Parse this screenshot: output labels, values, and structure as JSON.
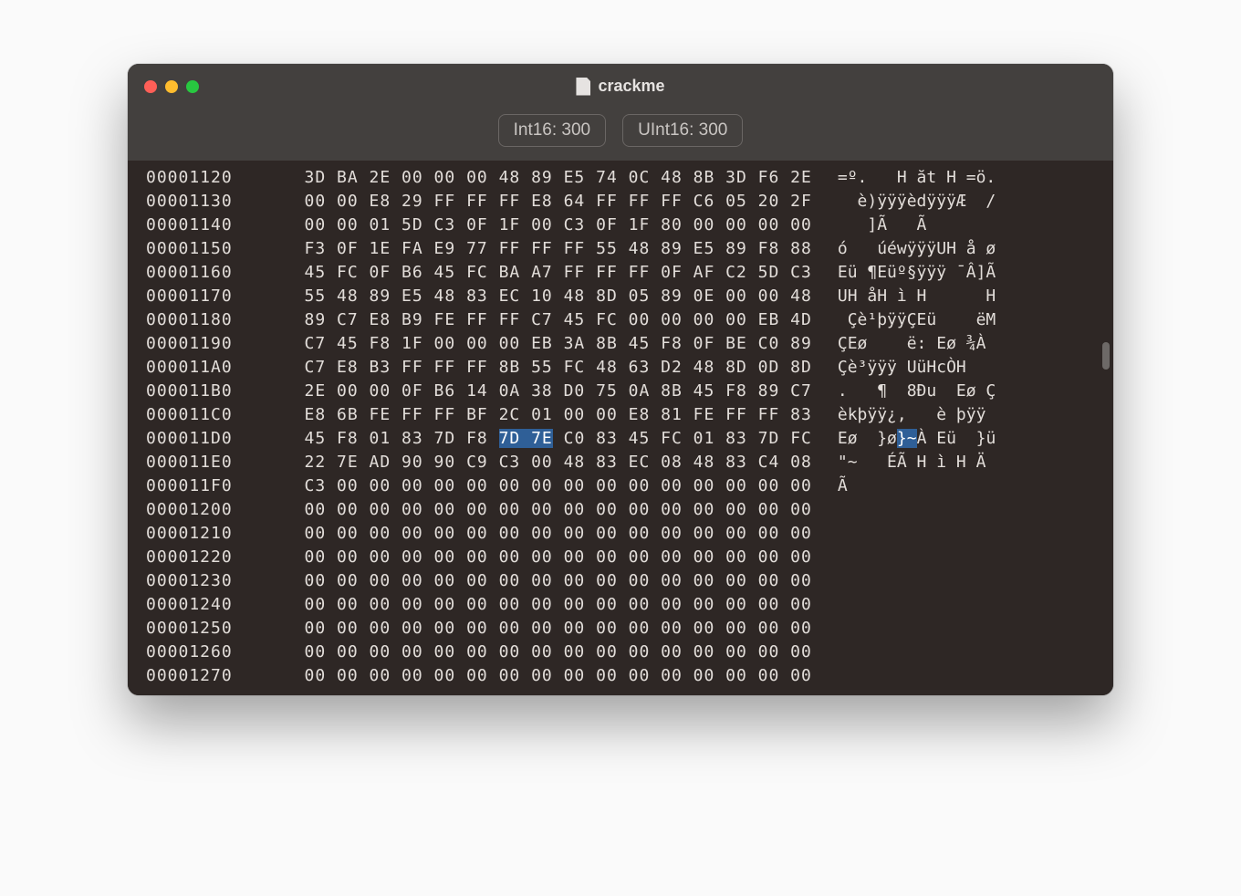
{
  "window": {
    "title": "crackme"
  },
  "info": {
    "int16": "Int16: 300",
    "uint16": "UInt16: 300"
  },
  "selection": {
    "row": 11,
    "hex_start": 6,
    "hex_end": 7,
    "ascii_col": 6
  },
  "rows": [
    {
      "addr": "00001120",
      "hex": [
        "3D",
        "BA",
        "2E",
        "00",
        "00",
        "00",
        "48",
        "89",
        "E5",
        "74",
        "0C",
        "48",
        "8B",
        "3D",
        "F6",
        "2E"
      ],
      "ascii": "=º.   H ăt H =ö."
    },
    {
      "addr": "00001130",
      "hex": [
        "00",
        "00",
        "E8",
        "29",
        "FF",
        "FF",
        "FF",
        "E8",
        "64",
        "FF",
        "FF",
        "FF",
        "C6",
        "05",
        "20",
        "2F"
      ],
      "ascii": "  è)ÿÿÿèdÿÿÿÆ  /"
    },
    {
      "addr": "00001140",
      "hex": [
        "00",
        "00",
        "01",
        "5D",
        "C3",
        "0F",
        "1F",
        "00",
        "C3",
        "0F",
        "1F",
        "80",
        "00",
        "00",
        "00",
        "00"
      ],
      "ascii": "   ]Ã   Ã       "
    },
    {
      "addr": "00001150",
      "hex": [
        "F3",
        "0F",
        "1E",
        "FA",
        "E9",
        "77",
        "FF",
        "FF",
        "FF",
        "55",
        "48",
        "89",
        "E5",
        "89",
        "F8",
        "88"
      ],
      "ascii": "ó   úéwÿÿÿUH å ø"
    },
    {
      "addr": "00001160",
      "hex": [
        "45",
        "FC",
        "0F",
        "B6",
        "45",
        "FC",
        "BA",
        "A7",
        "FF",
        "FF",
        "FF",
        "0F",
        "AF",
        "C2",
        "5D",
        "C3"
      ],
      "ascii": "Eü ¶Eüº§ÿÿÿ ¯Â]Ã"
    },
    {
      "addr": "00001170",
      "hex": [
        "55",
        "48",
        "89",
        "E5",
        "48",
        "83",
        "EC",
        "10",
        "48",
        "8D",
        "05",
        "89",
        "0E",
        "00",
        "00",
        "48"
      ],
      "ascii": "UH åH ì H      H"
    },
    {
      "addr": "00001180",
      "hex": [
        "89",
        "C7",
        "E8",
        "B9",
        "FE",
        "FF",
        "FF",
        "C7",
        "45",
        "FC",
        "00",
        "00",
        "00",
        "00",
        "EB",
        "4D"
      ],
      "ascii": " Çè¹þÿÿÇEü    ëM"
    },
    {
      "addr": "00001190",
      "hex": [
        "C7",
        "45",
        "F8",
        "1F",
        "00",
        "00",
        "00",
        "EB",
        "3A",
        "8B",
        "45",
        "F8",
        "0F",
        "BE",
        "C0",
        "89"
      ],
      "ascii": "ÇEø    ë: Eø ¾À "
    },
    {
      "addr": "000011A0",
      "hex": [
        "C7",
        "E8",
        "B3",
        "FF",
        "FF",
        "FF",
        "8B",
        "55",
        "FC",
        "48",
        "63",
        "D2",
        "48",
        "8D",
        "0D",
        "8D"
      ],
      "ascii": "Çè³ÿÿÿ UüHcÒH   "
    },
    {
      "addr": "000011B0",
      "hex": [
        "2E",
        "00",
        "00",
        "0F",
        "B6",
        "14",
        "0A",
        "38",
        "D0",
        "75",
        "0A",
        "8B",
        "45",
        "F8",
        "89",
        "C7"
      ],
      "ascii": ".   ¶  8Ðu  Eø Ç"
    },
    {
      "addr": "000011C0",
      "hex": [
        "E8",
        "6B",
        "FE",
        "FF",
        "FF",
        "BF",
        "2C",
        "01",
        "00",
        "00",
        "E8",
        "81",
        "FE",
        "FF",
        "FF",
        "83"
      ],
      "ascii": "èkþÿÿ¿,   è þÿÿ "
    },
    {
      "addr": "000011D0",
      "hex": [
        "45",
        "F8",
        "01",
        "83",
        "7D",
        "F8",
        "7D",
        "7E",
        "C0",
        "83",
        "45",
        "FC",
        "01",
        "83",
        "7D",
        "FC"
      ],
      "ascii": "Eø  }ø}~À Eü  }ü"
    },
    {
      "addr": "000011E0",
      "hex": [
        "22",
        "7E",
        "AD",
        "90",
        "90",
        "C9",
        "C3",
        "00",
        "48",
        "83",
        "EC",
        "08",
        "48",
        "83",
        "C4",
        "08"
      ],
      "ascii": "\"~   ÉÃ H ì H Ä "
    },
    {
      "addr": "000011F0",
      "hex": [
        "C3",
        "00",
        "00",
        "00",
        "00",
        "00",
        "00",
        "00",
        "00",
        "00",
        "00",
        "00",
        "00",
        "00",
        "00",
        "00"
      ],
      "ascii": "Ã               "
    },
    {
      "addr": "00001200",
      "hex": [
        "00",
        "00",
        "00",
        "00",
        "00",
        "00",
        "00",
        "00",
        "00",
        "00",
        "00",
        "00",
        "00",
        "00",
        "00",
        "00"
      ],
      "ascii": "                "
    },
    {
      "addr": "00001210",
      "hex": [
        "00",
        "00",
        "00",
        "00",
        "00",
        "00",
        "00",
        "00",
        "00",
        "00",
        "00",
        "00",
        "00",
        "00",
        "00",
        "00"
      ],
      "ascii": "                "
    },
    {
      "addr": "00001220",
      "hex": [
        "00",
        "00",
        "00",
        "00",
        "00",
        "00",
        "00",
        "00",
        "00",
        "00",
        "00",
        "00",
        "00",
        "00",
        "00",
        "00"
      ],
      "ascii": "                "
    },
    {
      "addr": "00001230",
      "hex": [
        "00",
        "00",
        "00",
        "00",
        "00",
        "00",
        "00",
        "00",
        "00",
        "00",
        "00",
        "00",
        "00",
        "00",
        "00",
        "00"
      ],
      "ascii": "                "
    },
    {
      "addr": "00001240",
      "hex": [
        "00",
        "00",
        "00",
        "00",
        "00",
        "00",
        "00",
        "00",
        "00",
        "00",
        "00",
        "00",
        "00",
        "00",
        "00",
        "00"
      ],
      "ascii": "                "
    },
    {
      "addr": "00001250",
      "hex": [
        "00",
        "00",
        "00",
        "00",
        "00",
        "00",
        "00",
        "00",
        "00",
        "00",
        "00",
        "00",
        "00",
        "00",
        "00",
        "00"
      ],
      "ascii": "                "
    },
    {
      "addr": "00001260",
      "hex": [
        "00",
        "00",
        "00",
        "00",
        "00",
        "00",
        "00",
        "00",
        "00",
        "00",
        "00",
        "00",
        "00",
        "00",
        "00",
        "00"
      ],
      "ascii": "                "
    },
    {
      "addr": "00001270",
      "hex": [
        "00",
        "00",
        "00",
        "00",
        "00",
        "00",
        "00",
        "00",
        "00",
        "00",
        "00",
        "00",
        "00",
        "00",
        "00",
        "00"
      ],
      "ascii": "                "
    }
  ]
}
